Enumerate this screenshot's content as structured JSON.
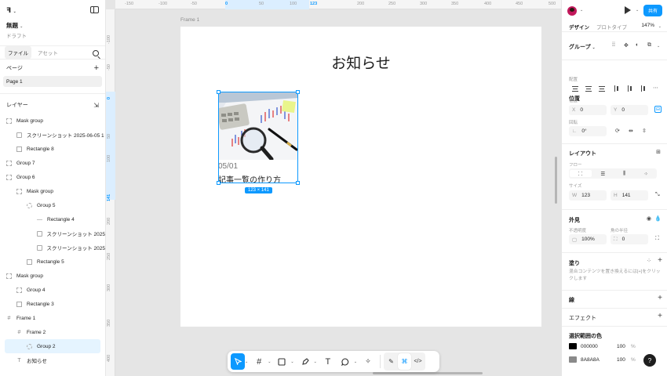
{
  "app": {
    "file_title": "無題",
    "file_status": "ドラフト"
  },
  "left_panel": {
    "tabs": [
      "ファイル",
      "アセット"
    ],
    "pages_label": "ページ",
    "pages": [
      "Page 1"
    ],
    "layers_label": "レイヤー",
    "layers": [
      {
        "name": "Mask group",
        "indent": 0,
        "icon": "dashed-square-icon"
      },
      {
        "name": "スクリーンショット 2025-06-05 1",
        "indent": 1,
        "icon": "image-icon"
      },
      {
        "name": "Rectangle 8",
        "indent": 1,
        "icon": "mask-icon"
      },
      {
        "name": "Group 7",
        "indent": 0,
        "icon": "dashed-square-icon"
      },
      {
        "name": "Group 6",
        "indent": 0,
        "icon": "dashed-square-icon"
      },
      {
        "name": "Mask group",
        "indent": 1,
        "icon": "dashed-square-icon"
      },
      {
        "name": "Group 5",
        "indent": 2,
        "icon": "dashed-circle-icon"
      },
      {
        "name": "Rectangle 4",
        "indent": 3,
        "icon": "line-icon"
      },
      {
        "name": "スクリーンショット 2025",
        "indent": 3,
        "icon": "image-icon"
      },
      {
        "name": "スクリーンショット 2025",
        "indent": 3,
        "icon": "image-icon"
      },
      {
        "name": "Rectangle 5",
        "indent": 2,
        "icon": "mask-icon"
      },
      {
        "name": "Mask group",
        "indent": 0,
        "icon": "dashed-square-icon"
      },
      {
        "name": "Group 4",
        "indent": 1,
        "icon": "dashed-square-icon"
      },
      {
        "name": "Rectangle 3",
        "indent": 1,
        "icon": "mask-icon"
      },
      {
        "name": "Frame 1",
        "indent": 0,
        "icon": "frame-icon"
      },
      {
        "name": "Frame 2",
        "indent": 1,
        "icon": "frame-icon"
      },
      {
        "name": "Group 2",
        "indent": 2,
        "icon": "dashed-circle-icon",
        "selected": true
      },
      {
        "name": "お知らせ",
        "indent": 1,
        "icon": "text-icon"
      }
    ]
  },
  "canvas": {
    "ruler_top": [
      {
        "label": "-150",
        "blue": false
      },
      {
        "label": "-100",
        "blue": false
      },
      {
        "label": "-50",
        "blue": false
      },
      {
        "label": "0",
        "blue": true
      },
      {
        "label": "50",
        "blue": false
      },
      {
        "label": "100",
        "blue": false
      },
      {
        "label": "123",
        "blue": true
      },
      {
        "label": "200",
        "blue": false
      },
      {
        "label": "250",
        "blue": false
      },
      {
        "label": "300",
        "blue": false
      },
      {
        "label": "350",
        "blue": false
      },
      {
        "label": "400",
        "blue": false
      },
      {
        "label": "450",
        "blue": false
      },
      {
        "label": "500",
        "blue": false
      }
    ],
    "ruler_left": [
      {
        "label": "-100",
        "blue": false
      },
      {
        "label": "-50",
        "blue": false
      },
      {
        "label": "0",
        "blue": true
      },
      {
        "label": "50",
        "blue": false
      },
      {
        "label": "100",
        "blue": false
      },
      {
        "label": "141",
        "blue": true
      },
      {
        "label": "200",
        "blue": false
      },
      {
        "label": "250",
        "blue": false
      },
      {
        "label": "300",
        "blue": false
      },
      {
        "label": "350",
        "blue": false
      },
      {
        "label": "400",
        "blue": false
      }
    ],
    "frame_label": "Frame 1",
    "heading": "お知らせ",
    "card_date": "05/01",
    "card_title": "記事一覧の作り方",
    "size_badge": "123 × 141"
  },
  "right_panel": {
    "share_label": "共有",
    "tabs": [
      "デザイン",
      "プロトタイプ"
    ],
    "zoom": "147%",
    "group_label": "グループ",
    "position": {
      "title": "位置",
      "align_label": "配置",
      "pos_label": "位置",
      "x_prefix": "X",
      "x": "0",
      "y_prefix": "Y",
      "y": "0",
      "rotation_label": "回転",
      "rotation": "0°"
    },
    "layout": {
      "title": "レイアウト",
      "flow_label": "フロー",
      "size_label": "サイズ",
      "w_prefix": "W",
      "w": "123",
      "h_prefix": "H",
      "h": "141"
    },
    "appearance": {
      "title": "外見",
      "opacity_label": "不透明度",
      "radius_label": "角の半径",
      "opacity": "100%",
      "radius": "0"
    },
    "fill": {
      "title": "塗り",
      "desc": "混合コンテンツを置き換えるには[+]をクリックします"
    },
    "stroke_title": "線",
    "effects_title": "エフェクト",
    "selection_colors": {
      "title": "選択範囲の色",
      "colors": [
        {
          "hex": "000000",
          "swatch": "#000000",
          "opacity": "100",
          "unit": "%"
        },
        {
          "hex": "8A8A8A",
          "swatch": "#8A8A8A",
          "opacity": "100",
          "unit": "%"
        }
      ]
    },
    "help_label": "?"
  },
  "toolbar": {
    "tools": [
      "move-tool",
      "frame-tool",
      "shape-tool",
      "pen-tool",
      "text-tool",
      "comment-tool",
      "actions-tool"
    ],
    "text_glyph": "T"
  },
  "colors": {
    "accent": "#0D99FF",
    "selection_bg": "#E5F4FF"
  }
}
